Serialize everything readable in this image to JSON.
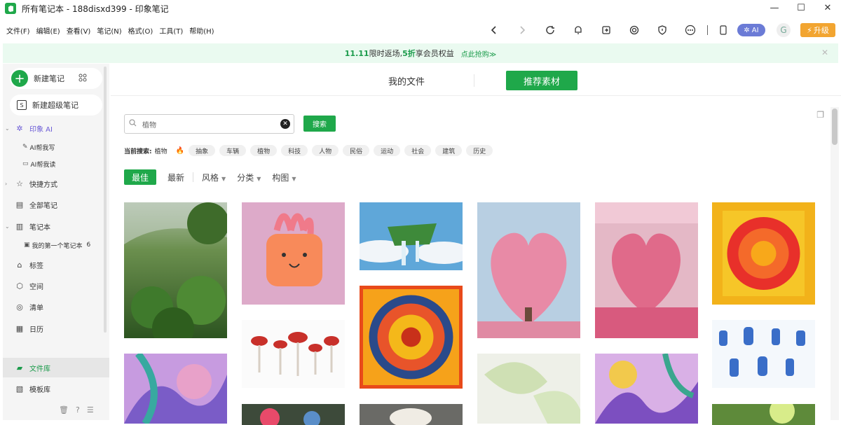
{
  "window": {
    "title": "所有笔记本 - 188disxd399 - 印象笔记",
    "minimize": "—",
    "maximize": "☐",
    "close": "✕"
  },
  "menu": [
    "文件(F)",
    "编辑(E)",
    "查看(V)",
    "笔记(N)",
    "格式(O)",
    "工具(T)",
    "帮助(H)"
  ],
  "toolbar": {
    "ai_label": "AI",
    "upgrade_label": "升级"
  },
  "promo": {
    "part1": "11.11",
    "part2": "限时返场,",
    "part3": "5折",
    "part4": "享会员权益",
    "link": "点此抢购≫"
  },
  "sidebar": {
    "new_note": "新建笔记",
    "new_super": "新建超级笔记",
    "ai": "印象 AI",
    "ai_write": "AI帮我写",
    "ai_read": "AI帮我读",
    "shortcuts": "快捷方式",
    "all_notes": "全部笔记",
    "notebooks": "笔记本",
    "first_notebook": "我的第一个笔记本",
    "first_notebook_count": "6",
    "tags": "标签",
    "spaces": "空间",
    "checklist": "清单",
    "calendar": "日历",
    "library": "文件库",
    "templates": "模板库"
  },
  "main": {
    "tab_files": "我的文件",
    "tab_recommended": "推荐素材",
    "search_value": "植物",
    "search_button": "搜索",
    "current_label": "当前搜索:",
    "current_value": "植物",
    "chips": [
      "抽象",
      "车辆",
      "植物",
      "科技",
      "人物",
      "民俗",
      "运动",
      "社会",
      "建筑",
      "历史"
    ],
    "filter_best": "最佳",
    "filter_newest": "最新",
    "filter_style": "风格",
    "filter_category": "分类",
    "filter_composition": "构图"
  },
  "colors": {
    "brand_green": "#1fa84a",
    "upgrade_orange": "#f2a531",
    "ai_purple": "#6b7bd6"
  }
}
